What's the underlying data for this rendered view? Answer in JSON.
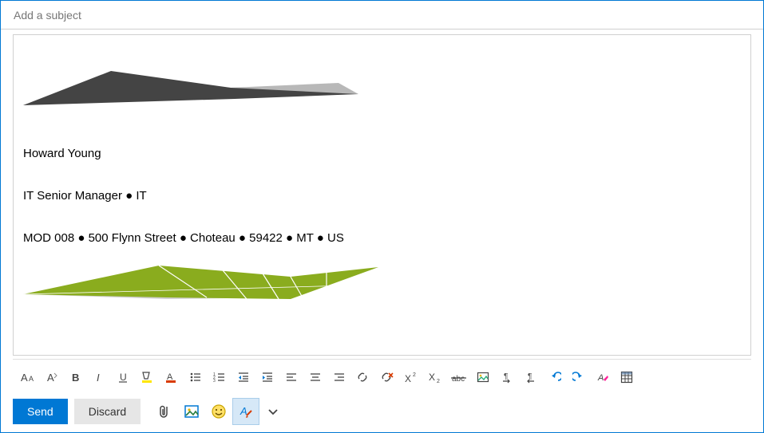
{
  "subject": {
    "placeholder": "Add a subject",
    "value": ""
  },
  "signature": {
    "name": "Howard Young",
    "title_line": "IT Senior Manager ● IT",
    "address_line": "MOD 008 ● 500 Flynn Street ● Choteau ● 59422 ● MT ● US"
  },
  "buttons": {
    "send": "Send",
    "discard": "Discard"
  },
  "colors": {
    "accent": "#0078d4",
    "olive": "#8aac1e",
    "gray": "#444444"
  }
}
